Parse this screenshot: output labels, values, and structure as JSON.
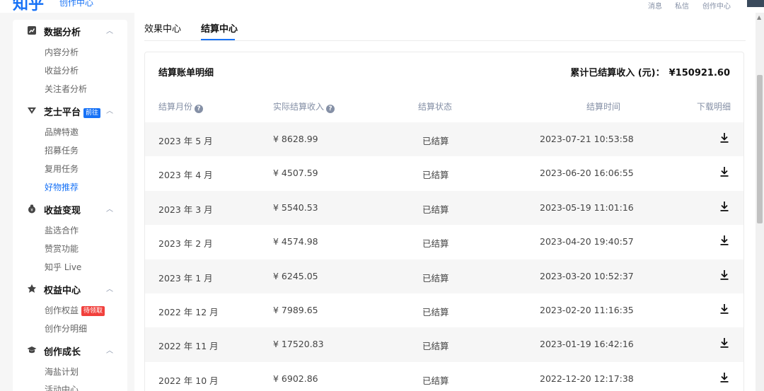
{
  "header": {
    "logo": "知乎",
    "logo_sub": "创作中心",
    "nav": [
      "消息",
      "私信",
      "创作中心"
    ]
  },
  "sidebar": {
    "sections": [
      {
        "label": "数据分析",
        "badge": "",
        "icon": "chart-icon",
        "items": [
          "内容分析",
          "收益分析",
          "关注者分析"
        ]
      },
      {
        "label": "芝士平台",
        "badge": "前往",
        "icon": "cheese-platform-icon",
        "items": [
          "品牌特邀",
          "招募任务",
          "复用任务",
          "好物推荐"
        ]
      },
      {
        "label": "收益变现",
        "badge": "",
        "icon": "money-bag-icon",
        "items": [
          "盐选合作",
          "赞赏功能",
          "知乎 Live"
        ]
      },
      {
        "label": "权益中心",
        "badge": "",
        "icon": "rights-icon",
        "items": [
          "创作权益",
          "创作分明细"
        ],
        "item_badge": "待领取"
      },
      {
        "label": "创作成长",
        "badge": "",
        "icon": "graduation-cap-icon",
        "items": [
          "海盐计划",
          "活动中心"
        ]
      }
    ],
    "active_item": "好物推荐"
  },
  "tabs": [
    {
      "label": "效果中心"
    },
    {
      "label": "结算中心"
    }
  ],
  "card": {
    "title": "结算账单明细",
    "total_label": "累计已结算收入 (元)：",
    "total_value": "¥150921.60"
  },
  "table": {
    "headers": [
      "结算月份",
      "实际结算收入",
      "结算状态",
      "结算时间",
      "下载明细"
    ],
    "rows": [
      {
        "month": "2023 年 5 月",
        "amount": "¥ 8628.99",
        "status": "已结算",
        "time": "2023-07-21 10:53:58"
      },
      {
        "month": "2023 年 4 月",
        "amount": "¥ 4507.59",
        "status": "已结算",
        "time": "2023-06-20 16:06:55"
      },
      {
        "month": "2023 年 3 月",
        "amount": "¥ 5540.53",
        "status": "已结算",
        "time": "2023-05-19 11:01:16"
      },
      {
        "month": "2023 年 2 月",
        "amount": "¥ 4574.98",
        "status": "已结算",
        "time": "2023-04-20 19:40:57"
      },
      {
        "month": "2023 年 1 月",
        "amount": "¥ 6245.05",
        "status": "已结算",
        "time": "2023-03-20 10:52:37"
      },
      {
        "month": "2022 年 12 月",
        "amount": "¥ 7989.65",
        "status": "已结算",
        "time": "2023-02-20 11:16:35"
      },
      {
        "month": "2022 年 11 月",
        "amount": "¥ 17520.83",
        "status": "已结算",
        "time": "2023-01-19 16:42:16"
      },
      {
        "month": "2022 年 10 月",
        "amount": "¥ 6902.86",
        "status": "已结算",
        "time": "2022-12-20 12:17:38"
      }
    ]
  },
  "colors": {
    "accent": "#1772f6",
    "badge_red": "#f1403c",
    "muted": "#8590a6"
  }
}
